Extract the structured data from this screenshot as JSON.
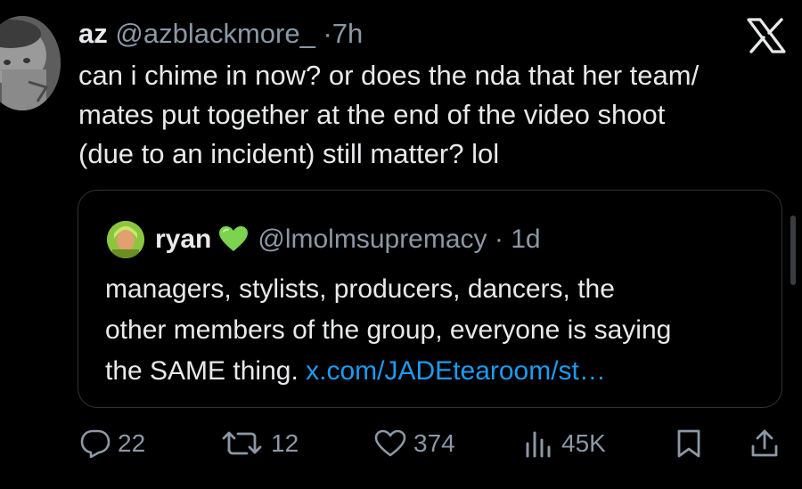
{
  "tweet": {
    "author_name": "az",
    "author_handle": "@azblackmore_",
    "separator": "·",
    "time": "7h",
    "text_lines": [
      "can i chime in now? or does the nda that her team/",
      "mates put together at the end of the video shoot",
      "(due to an incident) still matter? lol"
    ]
  },
  "quote": {
    "author_name": "ryan",
    "badge_icon": "green-heart-icon",
    "author_handle": "@lmolmsupremacy",
    "separator": "·",
    "time": "1d",
    "text_lines": [
      "managers, stylists, producers, dancers, the",
      "other members of the group, everyone is saying"
    ],
    "text_line3_prefix": "the SAME thing.",
    "link_text": "x.com/JADEtearoom/st…"
  },
  "actions": {
    "replies": "22",
    "reposts": "12",
    "likes": "374",
    "views": "45K"
  },
  "colors": {
    "background": "#000000",
    "text": "#e7e9ea",
    "muted": "#8b98a5",
    "link": "#1d9bf0",
    "border": "#2f3336",
    "heart": "#7bd34f"
  },
  "icons": [
    "x-logo-icon",
    "reply-icon",
    "repost-icon",
    "like-icon",
    "views-icon",
    "bookmark-icon",
    "share-icon"
  ]
}
